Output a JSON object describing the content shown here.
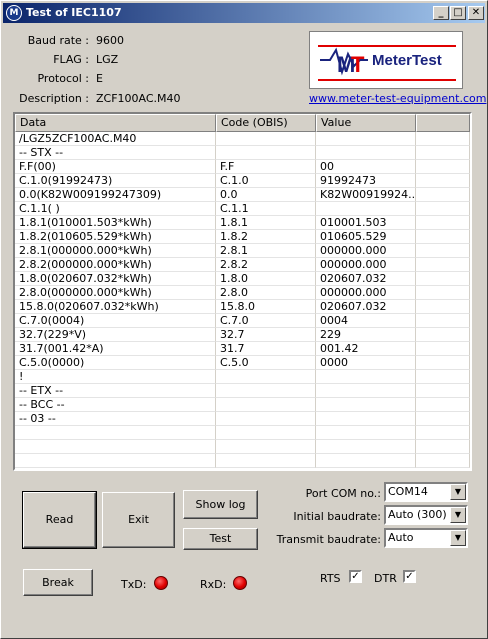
{
  "window": {
    "title": "Test of IEC1107",
    "minimize": "_",
    "maximize": "□",
    "close": "✕"
  },
  "info": [
    {
      "label": "Baud rate :",
      "value": "9600"
    },
    {
      "label": "FLAG :",
      "value": "LGZ"
    },
    {
      "label": "Protocol :",
      "value": "E"
    },
    {
      "label": "Description :",
      "value": "ZCF100AC.M40"
    }
  ],
  "logo": {
    "text": "MeterTest",
    "link": "www.meter-test-equipment.com",
    "accent": "#e00000",
    "brand": "#1a237e"
  },
  "table": {
    "headers": [
      "Data",
      "Code (OBIS)",
      "Value",
      ""
    ],
    "rows": [
      [
        "/LGZ5ZCF100AC.M40",
        "",
        "",
        ""
      ],
      [
        " -- STX --",
        "",
        "",
        ""
      ],
      [
        "F.F(00)",
        "F.F",
        "00",
        ""
      ],
      [
        "C.1.0(91992473)",
        "C.1.0",
        "91992473",
        ""
      ],
      [
        "0.0(K82W009199247309)",
        "0.0",
        "K82W00919924...",
        ""
      ],
      [
        "C.1.1(        )",
        "C.1.1",
        "",
        ""
      ],
      [
        "1.8.1(010001.503*kWh)",
        "1.8.1",
        "010001.503",
        ""
      ],
      [
        "1.8.2(010605.529*kWh)",
        "1.8.2",
        "010605.529",
        ""
      ],
      [
        "2.8.1(000000.000*kWh)",
        "2.8.1",
        "000000.000",
        ""
      ],
      [
        "2.8.2(000000.000*kWh)",
        "2.8.2",
        "000000.000",
        ""
      ],
      [
        "1.8.0(020607.032*kWh)",
        "1.8.0",
        "020607.032",
        ""
      ],
      [
        "2.8.0(000000.000*kWh)",
        "2.8.0",
        "000000.000",
        ""
      ],
      [
        "15.8.0(020607.032*kWh)",
        "15.8.0",
        "020607.032",
        ""
      ],
      [
        "C.7.0(0004)",
        "C.7.0",
        "0004",
        ""
      ],
      [
        "32.7(229*V)",
        "32.7",
        "229",
        ""
      ],
      [
        "31.7(001.42*A)",
        "31.7",
        "001.42",
        ""
      ],
      [
        "C.5.0(0000)",
        "C.5.0",
        "0000",
        ""
      ],
      [
        "!",
        "",
        "",
        ""
      ],
      [
        " -- ETX --",
        "",
        "",
        ""
      ],
      [
        " -- BCC --",
        "",
        "",
        ""
      ],
      [
        " -- 03 --",
        "",
        "",
        ""
      ],
      [
        "",
        "",
        "",
        ""
      ],
      [
        "",
        "",
        "",
        ""
      ],
      [
        "",
        "",
        "",
        ""
      ]
    ]
  },
  "buttons": {
    "read": "Read",
    "exit": "Exit",
    "show_log": "Show log",
    "test": "Test",
    "break": "Break"
  },
  "leds": {
    "txd": "TxD:",
    "rxd": "RxD:",
    "color": "#e00000"
  },
  "settings": {
    "port_label": "Port COM no.:",
    "port_value": "COM14",
    "initial_label": "Initial baudrate:",
    "initial_value": "Auto (300)",
    "transmit_label": "Transmit baudrate:",
    "transmit_value": "Auto"
  },
  "checks": {
    "rts": "RTS",
    "dtr": "DTR",
    "rts_checked": "✓",
    "dtr_checked": "✓"
  }
}
